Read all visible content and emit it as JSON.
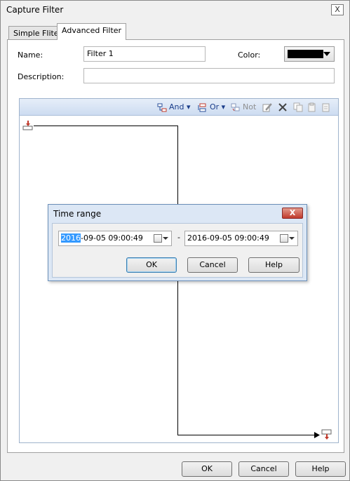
{
  "window": {
    "title": "Capture Filter",
    "close": "X"
  },
  "tabs": [
    {
      "label": "Simple Fliter",
      "active": false
    },
    {
      "label": "Advanced Filter",
      "active": true
    }
  ],
  "form": {
    "name_label": "Name:",
    "name_value": "Filter 1",
    "color_label": "Color:",
    "color_value": "#000000",
    "description_label": "Description:",
    "description_value": ""
  },
  "toolbar": {
    "and_label": "And",
    "or_label": "Or",
    "not_label": "Not"
  },
  "time_dialog": {
    "title": "Time range",
    "close": "X",
    "start_selected": "2016",
    "start_rest": "-09-05 09:00:49",
    "separator": "-",
    "end_value": "2016-09-05 09:00:49",
    "ok": "OK",
    "cancel": "Cancel",
    "help": "Help"
  },
  "footer": {
    "ok": "OK",
    "cancel": "Cancel",
    "help": "Help"
  }
}
